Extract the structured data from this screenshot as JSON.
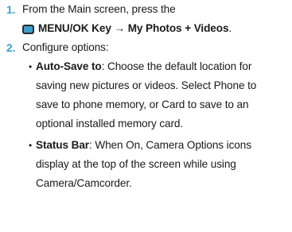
{
  "steps": [
    {
      "number": "1.",
      "line1": "From the Main screen, press the",
      "icon": "menu-ok-key-icon",
      "key_label": "MENU/OK Key",
      "arrow": "→",
      "target": "My Photos + Videos",
      "end": "."
    },
    {
      "number": "2.",
      "text": "Configure options:"
    }
  ],
  "options": [
    {
      "bullet": "•",
      "term": "Auto-Save to",
      "lines": [
        ": Choose the default location for",
        "saving new pictures or videos. Select Phone to",
        "save to phone memory, or Card to save to an",
        "optional installed memory card."
      ]
    },
    {
      "bullet": "•",
      "term": "Status Bar",
      "lines": [
        ": When On, Camera Options icons",
        "display at the top of the screen while using",
        "Camera/Camcorder."
      ]
    }
  ],
  "colors": {
    "accent": "#3aa0c8",
    "text": "#1a1a1a"
  }
}
